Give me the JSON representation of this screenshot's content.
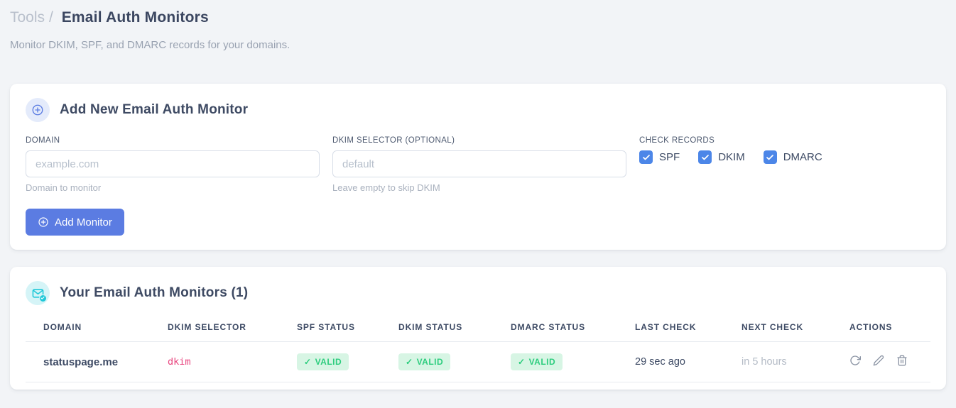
{
  "page": {
    "breadcrumb_section": "Tools",
    "breadcrumb_separator": "/",
    "title": "Email Auth Monitors",
    "subtitle": "Monitor DKIM, SPF, and DMARC records for your domains."
  },
  "add_monitor_card": {
    "icon": "plus-circle-icon",
    "title": "Add New Email Auth Monitor",
    "domain_field": {
      "label": "DOMAIN",
      "placeholder": "example.com",
      "value": "",
      "hint": "Domain to monitor"
    },
    "dkim_field": {
      "label": "DKIM SELECTOR (OPTIONAL)",
      "placeholder": "default",
      "value": "",
      "hint": "Leave empty to skip DKIM"
    },
    "check_records": {
      "label": "CHECK RECORDS",
      "options": [
        {
          "label": "SPF",
          "checked": true
        },
        {
          "label": "DKIM",
          "checked": true
        },
        {
          "label": "DMARC",
          "checked": true
        }
      ]
    },
    "submit_label": "Add Monitor"
  },
  "monitors_card": {
    "icon": "envelope-check-icon",
    "title": "Your Email Auth Monitors (1)",
    "table": {
      "headers": [
        "DOMAIN",
        "DKIM SELECTOR",
        "SPF STATUS",
        "DKIM STATUS",
        "DMARC STATUS",
        "LAST CHECK",
        "NEXT CHECK",
        "ACTIONS"
      ],
      "rows": [
        {
          "domain": "statuspage.me",
          "dkim_selector": "dkim",
          "spf_status": {
            "icon": "✓",
            "label": "VALID"
          },
          "dkim_status": {
            "icon": "✓",
            "label": "VALID"
          },
          "dmarc_status": {
            "icon": "✓",
            "label": "VALID"
          },
          "last_check": "29 sec ago",
          "next_check": "in 5 hours",
          "action_icons": [
            "refresh",
            "edit",
            "delete"
          ]
        }
      ]
    }
  },
  "colors": {
    "page_background": "#f2f4f7",
    "primary_button_blue": "#5b7ce2",
    "checkbox_blue": "#4c86e8",
    "valid_badge_background": "#d7f5e4",
    "valid_badge_text": "#2dcd7e",
    "code_pink": "#e8457f",
    "teal_icon": "#1fc8d8",
    "heading_dark": "#3b4660",
    "muted_gray": "#b4bbc6"
  }
}
